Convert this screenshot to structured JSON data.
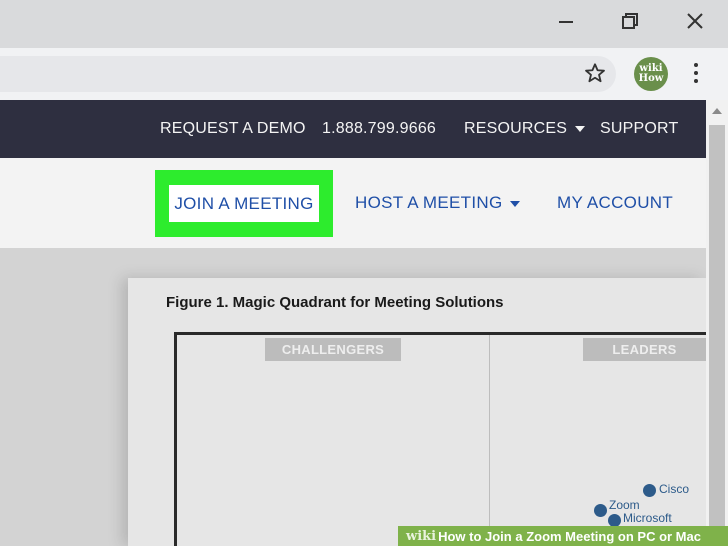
{
  "browser": {
    "profile_text_top": "wiki",
    "profile_text_bottom": "How",
    "accent": "#2dec2d"
  },
  "site": {
    "top_nav": {
      "request_demo": "REQUEST A DEMO",
      "phone": "1.888.799.9666",
      "resources": "RESOURCES",
      "support": "SUPPORT"
    },
    "sub_nav": {
      "join": "JOIN A MEETING",
      "host": "HOST A MEETING",
      "account": "MY ACCOUNT"
    },
    "figure": {
      "title": "Figure 1. Magic Quadrant for Meeting Solutions",
      "challengers": "CHALLENGERS",
      "leaders": "LEADERS",
      "vendors": [
        "Cisco",
        "Zoom",
        "Microsoft"
      ]
    }
  },
  "watermark": {
    "brand": "wiki",
    "text": "How to Join a Zoom Meeting on PC or Mac"
  }
}
